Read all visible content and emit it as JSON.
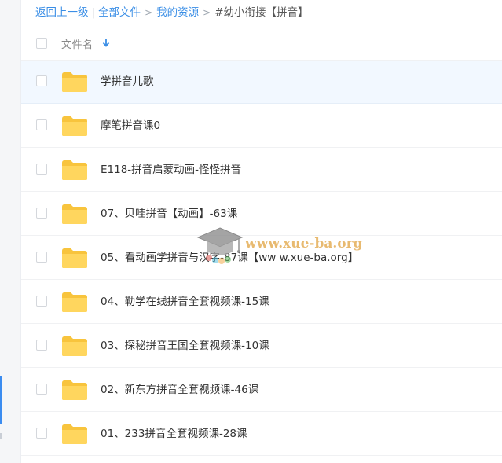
{
  "breadcrumb": {
    "back": "返回上一级",
    "all_files": "全部文件",
    "my_resources": "我的资源",
    "current": "#幼小衔接【拼音】"
  },
  "header": {
    "name_label": "文件名"
  },
  "files": [
    {
      "name": "学拼音儿歌",
      "type": "folder"
    },
    {
      "name": "摩笔拼音课0",
      "type": "folder"
    },
    {
      "name": "E118-拼音启蒙动画-怪怪拼音",
      "type": "folder"
    },
    {
      "name": "07、贝哇拼音【动画】-63课",
      "type": "folder"
    },
    {
      "name": "05、看动画学拼音与汉字-87课【ww w.xue-ba.org】",
      "type": "folder"
    },
    {
      "name": "04、勒学在线拼音全套视频课-15课",
      "type": "folder"
    },
    {
      "name": "03、探秘拼音王国全套视频课-10课",
      "type": "folder"
    },
    {
      "name": "02、新东方拼音全套视频课-46课",
      "type": "folder"
    },
    {
      "name": "01、233拼音全套视频课-28课",
      "type": "folder"
    }
  ],
  "watermark": {
    "text": "www.xue-ba.org"
  },
  "colors": {
    "link": "#3a8ee6",
    "folder": "#ffd25e",
    "hover_row": "#f2f8ff"
  }
}
